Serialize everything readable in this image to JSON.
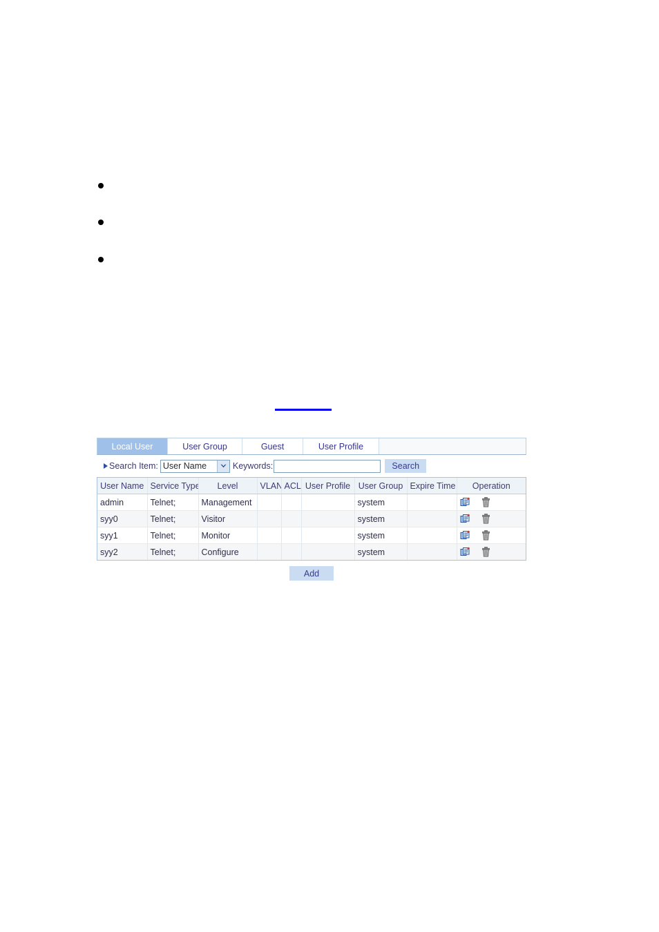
{
  "document": {
    "bullets": [
      "",
      "",
      ""
    ],
    "cross_reference_link": ""
  },
  "panel": {
    "tabs": [
      {
        "label": "Local User",
        "active": true
      },
      {
        "label": "User Group",
        "active": false
      },
      {
        "label": "Guest",
        "active": false
      },
      {
        "label": "User Profile",
        "active": false
      }
    ],
    "search": {
      "caret_icon": "triangle-right-icon",
      "label": "Search Item:",
      "select_value": "User Name",
      "select_arrow_icon": "chevron-down-icon",
      "keywords_label": "Keywords:",
      "keywords_value": "",
      "keywords_placeholder": "",
      "search_button": "Search"
    },
    "table": {
      "columns": [
        "User Name",
        "Service Type",
        "Level",
        "VLAN",
        "ACL",
        "User Profile",
        "User Group",
        "Expire Time",
        "Operation"
      ],
      "rows": [
        {
          "user_name": "admin",
          "service_type": "Telnet;",
          "level": "Management",
          "vlan": "",
          "acl": "",
          "user_profile": "",
          "user_group": "system",
          "expire_time": "",
          "edit_icon": "edit-document-icon",
          "delete_icon": "trash-icon"
        },
        {
          "user_name": "syy0",
          "service_type": "Telnet;",
          "level": "Visitor",
          "vlan": "",
          "acl": "",
          "user_profile": "",
          "user_group": "system",
          "expire_time": "",
          "edit_icon": "edit-document-icon",
          "delete_icon": "trash-icon"
        },
        {
          "user_name": "syy1",
          "service_type": "Telnet;",
          "level": "Monitor",
          "vlan": "",
          "acl": "",
          "user_profile": "",
          "user_group": "system",
          "expire_time": "",
          "edit_icon": "edit-document-icon",
          "delete_icon": "trash-icon"
        },
        {
          "user_name": "syy2",
          "service_type": "Telnet;",
          "level": "Configure",
          "vlan": "",
          "acl": "",
          "user_profile": "",
          "user_group": "system",
          "expire_time": "",
          "edit_icon": "edit-document-icon",
          "delete_icon": "trash-icon"
        }
      ]
    },
    "add_button": "Add"
  },
  "colors": {
    "active_tab_bg": "#9fc0e8",
    "button_bg": "#c9dcf2",
    "button_text": "#3a3a8c",
    "header_bg": "#eef3f8",
    "link": "#0000ee",
    "panel_border": "#a9c3dd",
    "row_alt_bg": "#f5f6f8"
  }
}
